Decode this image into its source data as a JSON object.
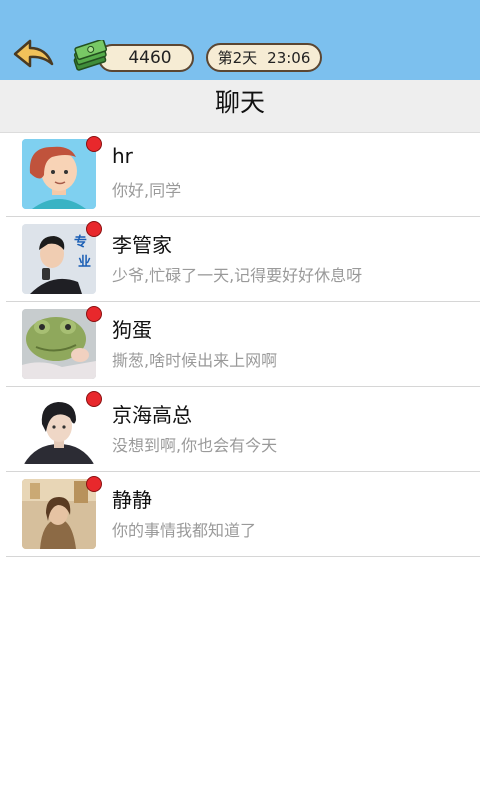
{
  "header": {
    "money": "4460",
    "day": "第2天",
    "time": "23:06"
  },
  "title": "聊天",
  "chats": [
    {
      "name": "hr",
      "message": "你好,同学"
    },
    {
      "name": "李管家",
      "message": "少爷,忙碌了一天,记得要好好休息呀",
      "avatar_text": "专业"
    },
    {
      "name": "狗蛋",
      "message": "撕葱,啥时候出来上网啊"
    },
    {
      "name": "京海高总",
      "message": "没想到啊,你也会有今天"
    },
    {
      "name": "静静",
      "message": "你的事情我都知道了"
    }
  ],
  "colors": {
    "topbar": "#7cc0ee",
    "badge": "#e8282c",
    "back_arrow": "#f2c25a"
  },
  "icons": {
    "back": "back-arrow-icon",
    "money": "cash-stack-icon"
  }
}
